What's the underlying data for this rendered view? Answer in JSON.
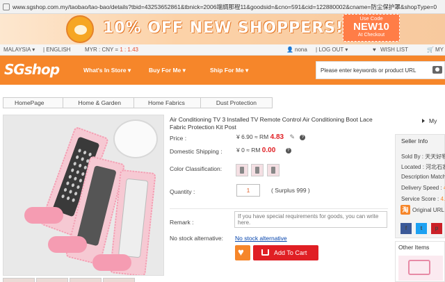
{
  "browser": {
    "url": "www.sgshop.com.my/taobao/tao-bao/details?tbid=43253652861&tbnick=2006端绸那程11&goodsid=&cno=591&cid=122880002&cname=防尘保护罩&shopType=0"
  },
  "banner": {
    "promo_text": "10% OFF NEW SHOPPERS!",
    "code_label": "Use Code",
    "code_value": "NEW10",
    "code_caption": "At Checkout"
  },
  "topbar": {
    "region": "MALAYSIA",
    "language": "ENGLISH",
    "rate_label": "MYR : CNY = ",
    "rate_value": "1 : 1.43",
    "user": "nona",
    "logout": "LOG OUT",
    "wishlist": "WISH LIST",
    "my": "MY"
  },
  "nav": {
    "logo": "SGshop",
    "menu": [
      "What's In Store",
      "Buy For Me",
      "Ship For Me"
    ],
    "search_placeholder": "Please enter keywords or product URL"
  },
  "breadcrumb": [
    "HomePage",
    "Home & Garden",
    "Home Fabrics",
    "Dust Protection"
  ],
  "product": {
    "title": "Air Conditioning TV 3 Installed TV Remote Control Air Conditioning Boot Lace Fabric Protection Kit Post",
    "price_label": "Price :",
    "price_original": "¥ 6.90 ≈ RM ",
    "price_rm": "4.83",
    "shipping_label": "Domestic Shipping :",
    "shipping_original": "¥ 0 ≈ RM ",
    "shipping_rm": "0.00",
    "color_label": "Color Classification:",
    "quantity_label": "Quantity :",
    "quantity_value": "1",
    "surplus": "( Surplus 999 )",
    "remark_label": "Remark :",
    "remark_placeholder": "If you have special requirements for goods, you can write here.",
    "nostock_label": "No stock alternative:",
    "nostock_link": "No stock alternative",
    "add_to_cart": "Add To Cart"
  },
  "sidebar": {
    "my_label": "My",
    "seller_title": "Seller Info",
    "sold_by": "Sold By : 天天好物",
    "located": "Located : 河北石家庄",
    "description": "Description Match",
    "delivery_label": "Delivery Speed : ",
    "delivery_value": "4.",
    "service_label": "Service Score : ",
    "service_value": "4.",
    "original_url": "Original URL",
    "share": [
      "f",
      "t",
      "p"
    ],
    "other_items": "Other Items"
  },
  "colors": {
    "brand_orange": "#f6862a",
    "price_red": "#e01f24",
    "link_blue": "#0645ad"
  }
}
